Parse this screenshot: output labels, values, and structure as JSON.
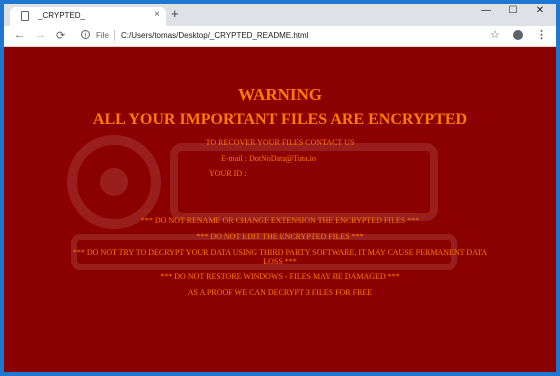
{
  "browser": {
    "tab_title": "_CRYPTED_",
    "tab_close": "×",
    "new_tab": "+",
    "window_controls": {
      "minimize": "—",
      "maximize": "☐",
      "close": "✕"
    },
    "nav": {
      "back": "←",
      "forward": "→",
      "reload": "⟳"
    },
    "scheme_label": "File",
    "url": "C:/Users/tomas/Desktop/_CRYPTED_README.html",
    "bookmark_icon": "star-icon",
    "profile_icon": "account-icon",
    "menu_icon": "⋮"
  },
  "ransom_note": {
    "background_color": "#8b0000",
    "text_color": "#ff7a00",
    "heading": "WARNING",
    "subheading": "ALL YOUR IMPORTANT FILES ARE ENCRYPTED",
    "recover_line": "TO RECOVER YOUR FILES CONTACT US",
    "email_line": "E-mail : DotNoData@Tuta.io",
    "id_line": "YOUR ID :",
    "warnings": [
      "*** DO NOT RENAME OR CHANGE EXTENSION THE ENCRYPTED FILES ***",
      "*** DO NOT EDIT THE ENCRYPTED FILES ***",
      "*** DO NOT TRY TO DECRYPT YOUR DATA USING THIRD PARTY SOFTWARE, IT MAY CAUSE PERMANENT DATA",
      "LOSS ***",
      "*** DO NOT RESTORE WINDOWS - FILES MAY BE DAMAGED ***"
    ],
    "proof_line": "AS A PROOF WE CAN DECRYPT 3 FILES FOR FREE"
  }
}
